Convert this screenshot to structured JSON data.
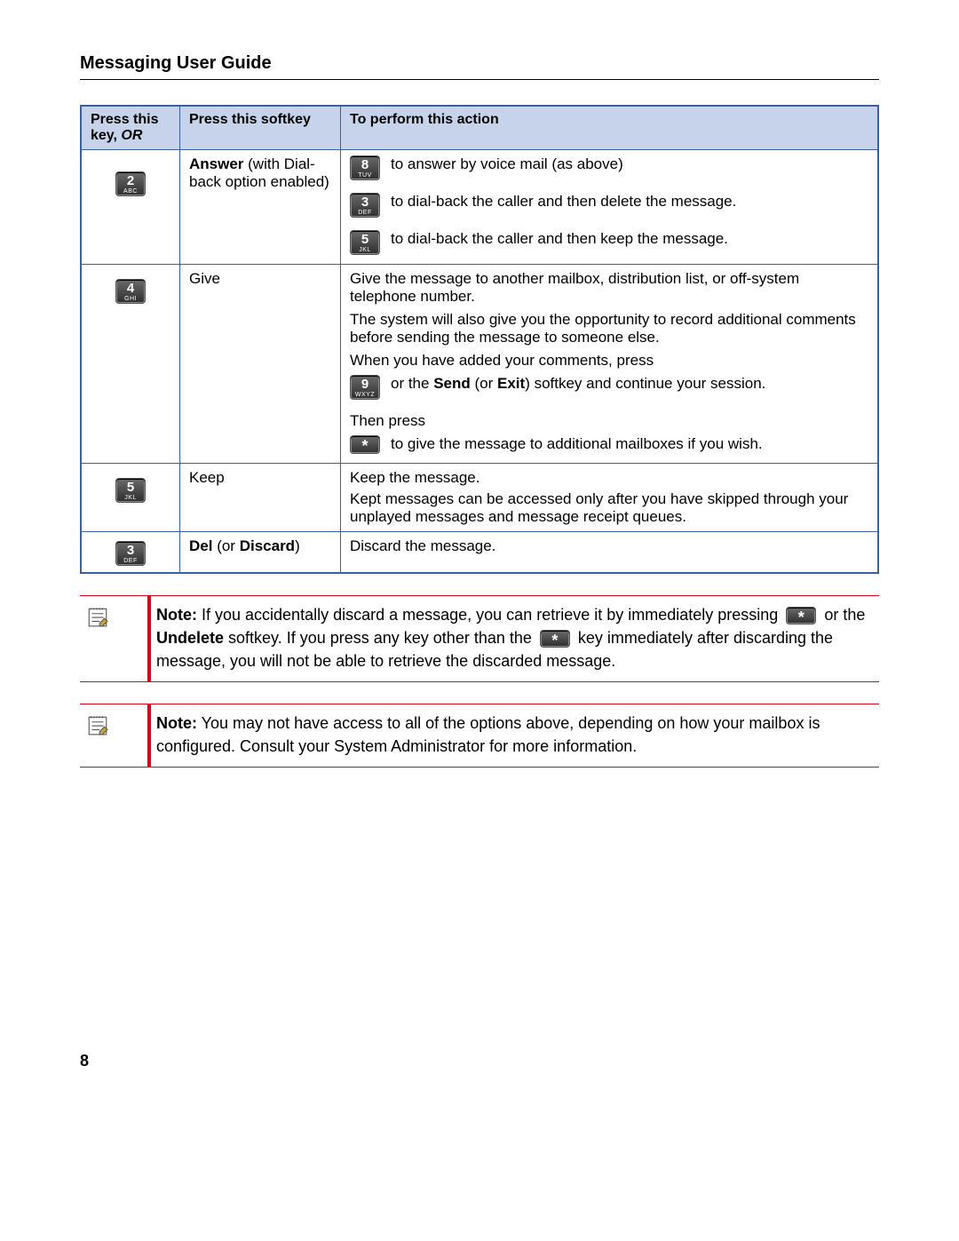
{
  "title": "Messaging User Guide",
  "page_number": "8",
  "header": {
    "col_key_l1": "Press this",
    "col_key_l2": "key,",
    "col_key_or": "OR",
    "col_softkey": "Press this softkey",
    "col_action": "To perform this action"
  },
  "keys": {
    "k2": {
      "num": "2",
      "sub": "ABC"
    },
    "k3": {
      "num": "3",
      "sub": "DEF"
    },
    "k4": {
      "num": "4",
      "sub": "GHI"
    },
    "k5": {
      "num": "5",
      "sub": "JKL"
    },
    "k8": {
      "num": "8",
      "sub": "TUV"
    },
    "k9": {
      "num": "9",
      "sub": "WXYZ"
    },
    "star": {
      "num": "*",
      "sub": ""
    }
  },
  "rows": {
    "answer": {
      "soft_strong": "Answer",
      "soft_rest1": " (with Dial-back option enabled)",
      "act8": "to answer by voice mail (as above)",
      "act3": "to dial-back the caller and then delete the message.",
      "act5": "to dial-back the caller and then keep the message."
    },
    "give": {
      "soft": "Give",
      "p1": "Give the message to another mailbox, distribution list, or off-system telephone number.",
      "p2": "The system will also give you the opportunity to record additional comments before sending the message to someone else.",
      "p3": "When you have added your comments, press",
      "p4a": "or the ",
      "p4b_strong": "Send",
      "p4c": " (or ",
      "p4d_strong": "Exit",
      "p4e": ") softkey and continue your session.",
      "p5": "Then press",
      "p6": "to give the message to additional mailboxes if you wish."
    },
    "keep": {
      "soft": "Keep",
      "p1": "Keep the message.",
      "p2": "Kept messages can be accessed only after you have skipped through your unplayed messages and message receipt queues."
    },
    "discard": {
      "soft_strong1": "Del",
      "soft_mid": " (or ",
      "soft_strong2": "Discard",
      "soft_end": ")",
      "p1": "Discard the message."
    }
  },
  "notes": {
    "n1": {
      "lead": "Note:",
      "t1": " If you accidentally discard a message, you can retrieve it by immediately pressing ",
      "t2a": " or the ",
      "t2b_strong": "Undelete",
      "t2c": " softkey. If you press any key other than the ",
      "t3": " key immediately after discarding the message, you will not be able to retrieve the discarded message."
    },
    "n2": {
      "lead": "Note:",
      "t1": " You may not have access to all of the options above, depending on how your mailbox is configured. Consult your System Administrator for more information."
    }
  }
}
